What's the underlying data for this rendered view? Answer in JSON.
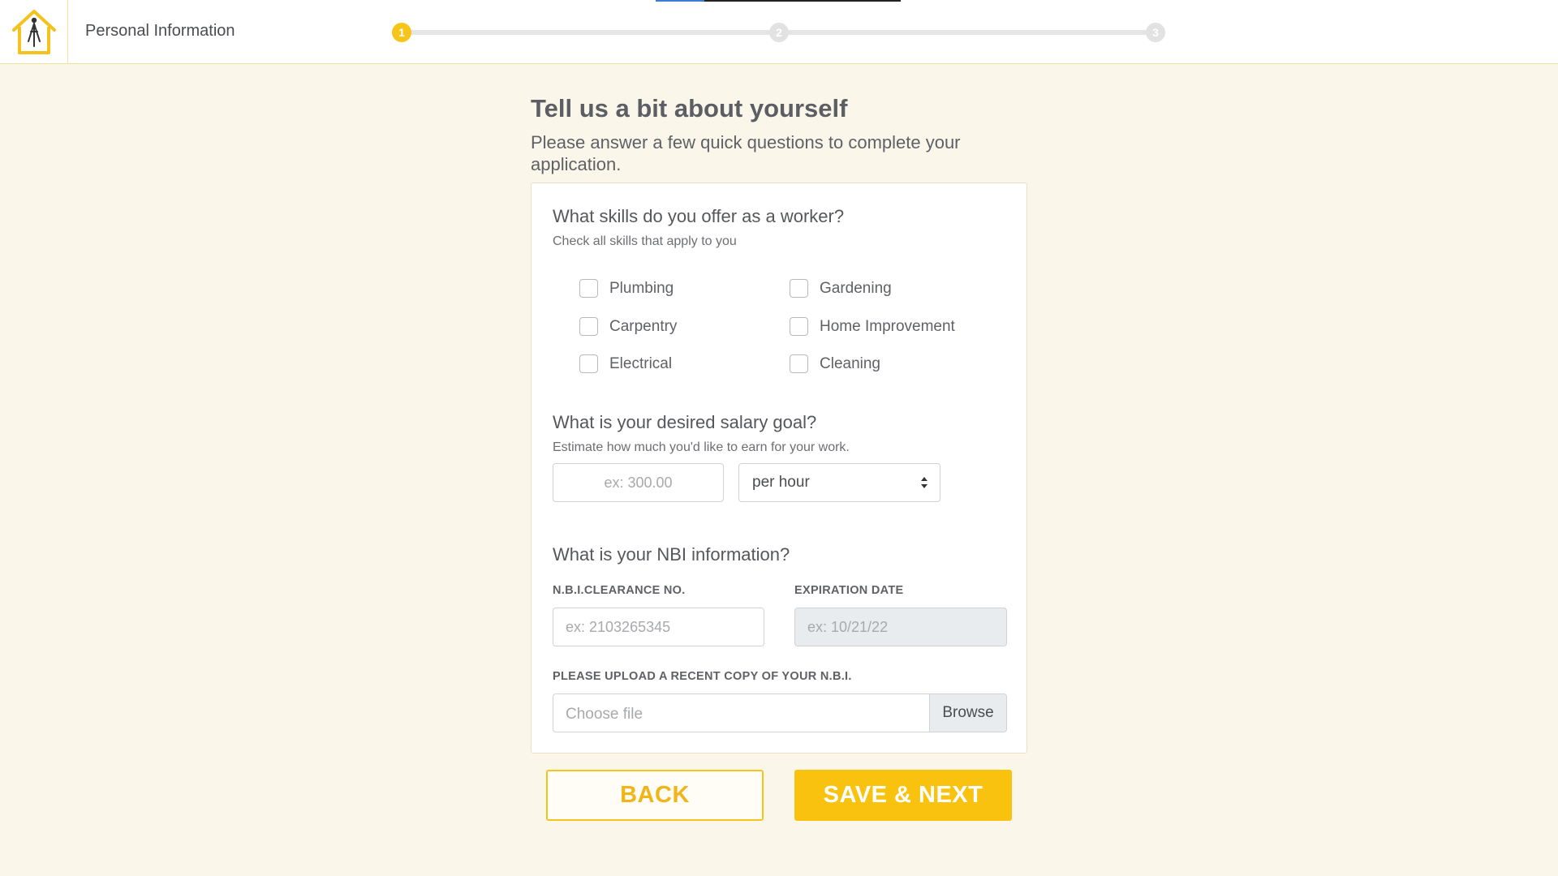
{
  "header": {
    "step_title": "Personal Information",
    "steps": [
      "1",
      "2",
      "3"
    ],
    "current_step": 1
  },
  "intro": {
    "title": "Tell us a bit about yourself",
    "subtitle": "Please answer a few quick questions to complete your application."
  },
  "skills": {
    "title": "What skills do you offer as a worker?",
    "subtitle": "Check all skills that apply to you",
    "options": [
      "Plumbing",
      "Carpentry",
      "Electrical",
      "Gardening",
      "Home Improvement",
      "Cleaning"
    ]
  },
  "salary": {
    "title": "What is your desired salary goal?",
    "subtitle": "Estimate how much you'd like to earn for your work.",
    "amount_placeholder": "ex: 300.00",
    "period_selected": "per hour"
  },
  "nbi": {
    "title": "What is your NBI information?",
    "clearance_label": "N.B.I.CLEARANCE NO.",
    "clearance_placeholder": "ex: 2103265345",
    "expiration_label": "EXPIRATION DATE",
    "expiration_placeholder": "ex: 10/21/22",
    "upload_label": "PLEASE UPLOAD A RECENT COPY OF YOUR N.B.I.",
    "file_placeholder": "Choose file",
    "browse_label": "Browse"
  },
  "actions": {
    "back_label": "BACK",
    "next_label": "SAVE & NEXT"
  },
  "colors": {
    "accent": "#f9c20f",
    "background": "#faf7ea"
  }
}
